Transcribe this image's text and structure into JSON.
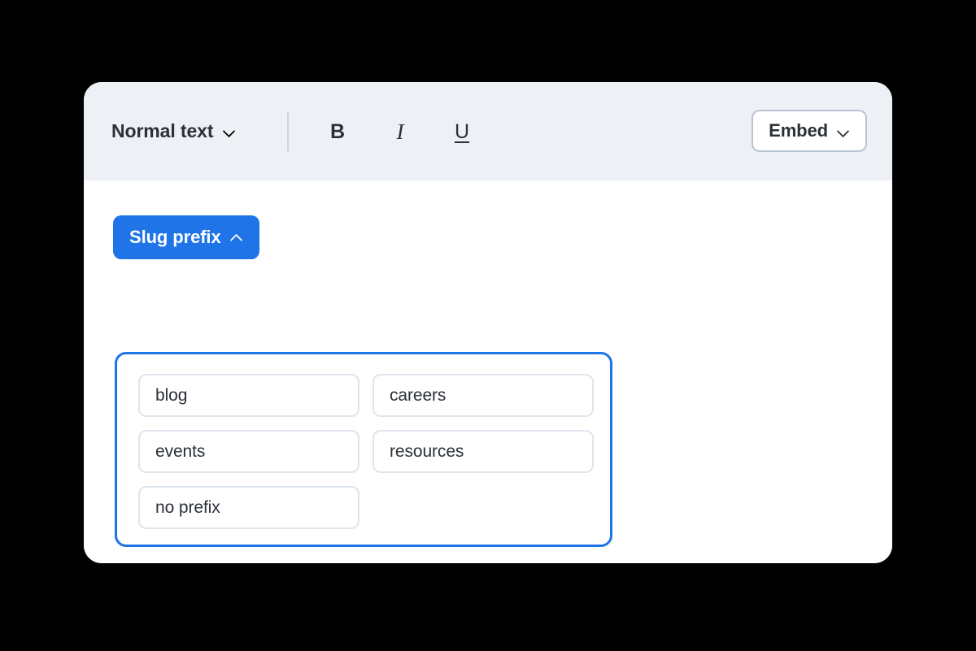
{
  "card": {
    "toolbar": {
      "style_select": {
        "label": "Normal text",
        "chevron": "chevron-down-icon"
      },
      "format_buttons": [
        {
          "name": "bold",
          "glyph": "B"
        },
        {
          "name": "italic",
          "glyph": "I"
        },
        {
          "name": "underline",
          "glyph": "U"
        }
      ],
      "embed_button": {
        "label": "Embed",
        "chevron": "chevron-down-icon"
      }
    },
    "body": {
      "slug_button": {
        "label": "Slug prefix",
        "chevron": "chevron-up-icon",
        "expanded": true
      },
      "prefix_panel": {
        "options": [
          {
            "label": "blog"
          },
          {
            "label": "careers"
          },
          {
            "label": "events"
          },
          {
            "label": "resources"
          },
          {
            "label": "no prefix"
          }
        ]
      }
    }
  },
  "colors": {
    "accent_blue": "#1f74e8",
    "toolbar_bg": "#edf0f5",
    "card_bg": "#ffffff",
    "page_bg": "#000000",
    "text_dark": "#2c3137",
    "chip_border": "#dfe5ed",
    "embed_border": "#b8c4d4",
    "divider": "#ccd6e2"
  }
}
